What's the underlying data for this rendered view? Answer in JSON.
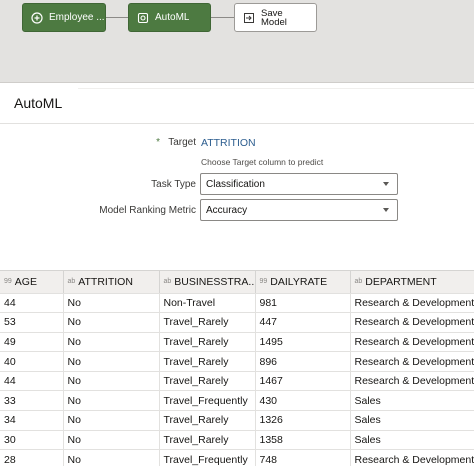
{
  "flow": {
    "nodes": [
      {
        "label": "Employee ...",
        "icon": "plus-circle-icon"
      },
      {
        "label": "AutoML",
        "icon": "automl-gear-icon"
      },
      {
        "label": "Save Model",
        "icon": "save-arrow-icon"
      }
    ]
  },
  "panel": {
    "title": "AutoML"
  },
  "form": {
    "target_required_mark": "*",
    "target_label": "Target",
    "target_value": "ATTRITION",
    "target_hint": "Choose Target column to predict",
    "task_type_label": "Task Type",
    "task_type_value": "Classification",
    "ranking_label": "Model Ranking Metric",
    "ranking_value": "Accuracy"
  },
  "table": {
    "columns": [
      {
        "type": "99",
        "name": "AGE"
      },
      {
        "type": "ab",
        "name": "ATTRITION"
      },
      {
        "type": "ab",
        "name": "BUSINESSTRA..."
      },
      {
        "type": "99",
        "name": "DAILYRATE"
      },
      {
        "type": "ab",
        "name": "DEPARTMENT"
      }
    ],
    "rows": [
      [
        "44",
        "No",
        "Non-Travel",
        "981",
        "Research & Development"
      ],
      [
        "53",
        "No",
        "Travel_Rarely",
        "447",
        "Research & Development"
      ],
      [
        "49",
        "No",
        "Travel_Rarely",
        "1495",
        "Research & Development"
      ],
      [
        "40",
        "No",
        "Travel_Rarely",
        "896",
        "Research & Development"
      ],
      [
        "44",
        "No",
        "Travel_Rarely",
        "1467",
        "Research & Development"
      ],
      [
        "33",
        "No",
        "Travel_Frequently",
        "430",
        "Sales"
      ],
      [
        "34",
        "No",
        "Travel_Rarely",
        "1326",
        "Sales"
      ],
      [
        "30",
        "No",
        "Travel_Rarely",
        "1358",
        "Sales"
      ],
      [
        "28",
        "No",
        "Travel_Frequently",
        "748",
        "Research & Development"
      ]
    ]
  }
}
